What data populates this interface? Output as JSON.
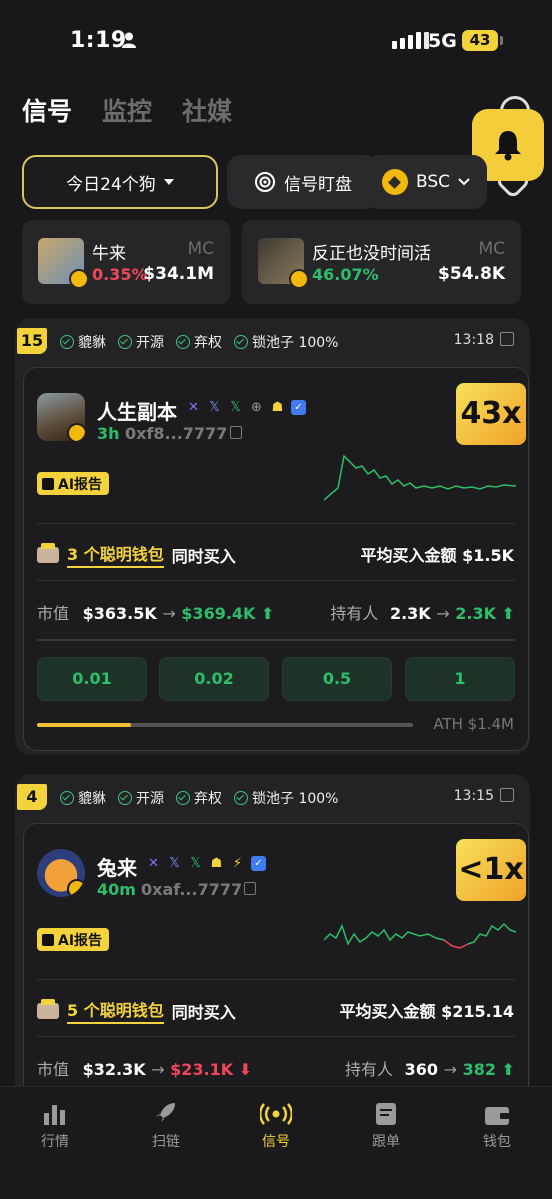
{
  "status": {
    "time": "1:19",
    "network": "5G",
    "battery": "43"
  },
  "tabs": [
    {
      "label": "信号",
      "active": true
    },
    {
      "label": "监控",
      "active": false
    },
    {
      "label": "社媒",
      "active": false
    }
  ],
  "filters": {
    "dog": "今日24个狗",
    "watch": "信号盯盘",
    "chain": "BSC"
  },
  "mc_cards": [
    {
      "name": "牛来",
      "tag": "MC",
      "pct": "0.35%",
      "value": "$34.1M",
      "pct_color": "#f0455a"
    },
    {
      "name": "反正也没时间活",
      "tag": "MC",
      "pct": "46.07%",
      "value": "$54.8K",
      "pct_color": "#2ebd6a"
    }
  ],
  "signals": [
    {
      "rank": "15",
      "tags": [
        "貔貅",
        "开源",
        "弃权",
        "锁池子 100%"
      ],
      "time": "13:18",
      "name": "人生副本",
      "age": "3h",
      "address": "0xf8...7777",
      "multiplier": "43x",
      "ai_label": "AI报告",
      "smart_count": "3 个聪明钱包",
      "smart_suffix": "同时买入",
      "avg_label": "平均买入金额",
      "avg_value": "$1.5K",
      "mcap_label": "市值",
      "mcap_from": "$363.5K",
      "mcap_to": "$369.4K",
      "holders_label": "持有人",
      "holders_from": "2.3K",
      "holders_to": "2.3K",
      "amounts": [
        "0.01",
        "0.02",
        "0.5",
        "1"
      ],
      "progress": 0.25,
      "ath": "ATH $1.4M"
    },
    {
      "rank": "4",
      "tags": [
        "貔貅",
        "开源",
        "弃权",
        "锁池子 100%"
      ],
      "time": "13:15",
      "name": "兔来",
      "age": "40m",
      "address": "0xaf...7777",
      "multiplier": "<1x",
      "ai_label": "AI报告",
      "smart_count": "5 个聪明钱包",
      "smart_suffix": "同时买入",
      "avg_label": "平均买入金额",
      "avg_value": "$215.14",
      "mcap_label": "市值",
      "mcap_from": "$32.3K",
      "mcap_to": "$23.1K",
      "holders_label": "持有人",
      "holders_from": "360",
      "holders_to": "382"
    }
  ],
  "bottom_nav": [
    {
      "label": "行情",
      "icon": "bar-chart-icon"
    },
    {
      "label": "扫链",
      "icon": "rocket-icon"
    },
    {
      "label": "信号",
      "icon": "broadcast-icon",
      "active": true
    },
    {
      "label": "跟单",
      "icon": "document-icon"
    },
    {
      "label": "钱包",
      "icon": "wallet-icon"
    }
  ]
}
